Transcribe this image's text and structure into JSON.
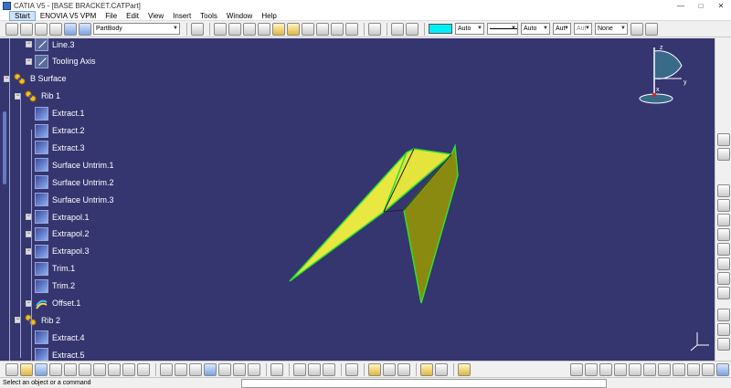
{
  "window": {
    "title": "CATIA V5 - [BASE BRACKET.CATPart]",
    "controls": [
      "—",
      "□",
      "✕"
    ]
  },
  "menu": {
    "items": [
      "Start",
      "ENOVIA V5 VPM",
      "File",
      "Edit",
      "View",
      "Insert",
      "Tools",
      "Window",
      "Help"
    ]
  },
  "toolbar": {
    "body_select": "PartBody",
    "color_value": "Auto",
    "linetype_value": "Auto",
    "thickness_value": "Aut",
    "point_value": "Aut",
    "layer_value": "None"
  },
  "tree": {
    "items": [
      {
        "label": "Line.3",
        "type": "line",
        "level": 3
      },
      {
        "label": "Tooling Axis",
        "type": "line",
        "level": 3
      },
      {
        "label": "B Surface",
        "type": "surfset",
        "level": 1
      },
      {
        "label": "Rib 1",
        "type": "rib",
        "level": 2
      },
      {
        "label": "Extract.1",
        "type": "extract",
        "level": 3
      },
      {
        "label": "Extract.2",
        "type": "extract",
        "level": 3
      },
      {
        "label": "Extract.3",
        "type": "extract",
        "level": 3
      },
      {
        "label": "Surface Untrim.1",
        "type": "extract",
        "level": 3
      },
      {
        "label": "Surface Untrim.2",
        "type": "extract",
        "level": 3
      },
      {
        "label": "Surface Untrim.3",
        "type": "extract",
        "level": 3
      },
      {
        "label": "Extrapol.1",
        "type": "extract",
        "level": 3
      },
      {
        "label": "Extrapol.2",
        "type": "extract",
        "level": 3
      },
      {
        "label": "Extrapol.3",
        "type": "extract",
        "level": 3
      },
      {
        "label": "Trim.1",
        "type": "extract",
        "level": 3
      },
      {
        "label": "Trim.2",
        "type": "extract",
        "level": 3
      },
      {
        "label": "Offset.1",
        "type": "offset",
        "level": 3
      },
      {
        "label": "Rib 2",
        "type": "rib",
        "level": 2
      },
      {
        "label": "Extract.4",
        "type": "extract",
        "level": 3
      },
      {
        "label": "Extract.5",
        "type": "extract",
        "level": 3
      }
    ]
  },
  "compass": {
    "axis_z": "z",
    "axis_y": "y",
    "axis_x": "x"
  },
  "status": {
    "prompt": "Select an object or a command"
  },
  "colors": {
    "viewport_bg": "#353570",
    "surface_yellow": "#e8e840",
    "surface_olive": "#8a8a10",
    "edge_green": "#30e030"
  },
  "icons": [
    "catia-icon",
    "minimize-icon",
    "maximize-icon",
    "close-icon",
    "compass-icon",
    "axis-icon",
    "line-icon",
    "rib-icon",
    "extract-icon",
    "offset-icon"
  ]
}
